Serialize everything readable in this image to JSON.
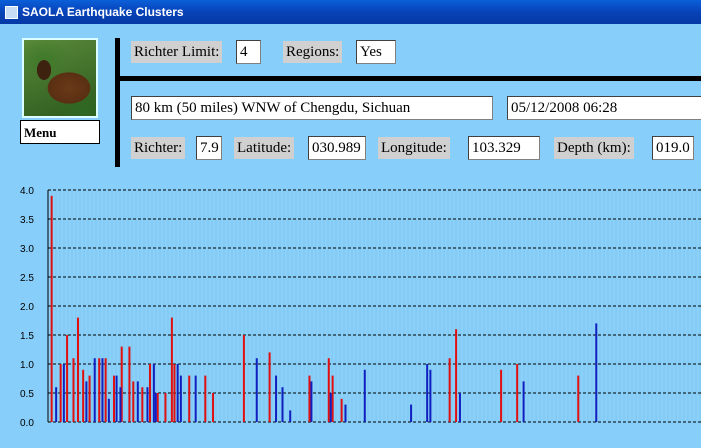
{
  "window": {
    "title": "SAOLA Earthquake Clusters"
  },
  "menu": {
    "label": "Menu"
  },
  "controls": {
    "richter_limit_label": "Richter Limit:",
    "richter_limit_value": "4",
    "regions_label": "Regions:",
    "regions_value": "Yes"
  },
  "event": {
    "location": "80 km (50 miles) WNW of Chengdu, Sichuan",
    "datetime": "05/12/2008 06:28",
    "richter_label": "Richter:",
    "richter_value": "7.9",
    "latitude_label": "Latitude:",
    "latitude_value": "030.989",
    "longitude_label": "Longitude:",
    "longitude_value": "103.329",
    "depth_label": "Depth (km):",
    "depth_value": "019.0"
  },
  "colors": {
    "background": "#87CEFA",
    "red": "#e01010",
    "blue": "#1020c0"
  },
  "chart_data": {
    "type": "bar",
    "yticks": [
      "0.0",
      "0.5",
      "1.0",
      "1.5",
      "2.0",
      "2.5",
      "3.0",
      "3.5",
      "4.0"
    ],
    "ylim": [
      0,
      4.0
    ],
    "grid": true,
    "series": [
      {
        "color": "red",
        "values": [
          [
            0.1,
            3.9
          ],
          [
            1.5,
            1.0
          ],
          [
            2.5,
            1.5
          ],
          [
            3.5,
            1.1
          ],
          [
            4.2,
            1.8
          ],
          [
            5.0,
            0.9
          ],
          [
            6.0,
            0.8
          ],
          [
            7.5,
            1.1
          ],
          [
            8.5,
            1.1
          ],
          [
            9.8,
            0.8
          ],
          [
            11.0,
            1.3
          ],
          [
            12.2,
            1.3
          ],
          [
            12.8,
            0.7
          ],
          [
            14.2,
            0.6
          ],
          [
            15.4,
            1.0
          ],
          [
            16.6,
            0.5
          ],
          [
            17.8,
            0.5
          ],
          [
            18.8,
            1.8
          ],
          [
            19.2,
            1.0
          ],
          [
            21.5,
            0.8
          ],
          [
            24.0,
            0.8
          ],
          [
            25.2,
            0.5
          ],
          [
            30.0,
            1.5
          ],
          [
            34.0,
            1.2
          ],
          [
            40.2,
            0.8
          ],
          [
            43.2,
            1.1
          ],
          [
            43.8,
            0.8
          ],
          [
            45.2,
            0.4
          ],
          [
            62.0,
            1.1
          ],
          [
            63.0,
            1.6
          ],
          [
            70.0,
            0.9
          ],
          [
            72.5,
            1.0
          ],
          [
            82.0,
            0.8
          ]
        ]
      },
      {
        "color": "blue",
        "values": [
          [
            0.8,
            0.6
          ],
          [
            2.0,
            1.0
          ],
          [
            5.5,
            0.7
          ],
          [
            6.8,
            1.1
          ],
          [
            8.0,
            1.1
          ],
          [
            9.0,
            0.4
          ],
          [
            10.2,
            0.8
          ],
          [
            10.8,
            0.6
          ],
          [
            13.5,
            0.7
          ],
          [
            15.0,
            0.6
          ],
          [
            16.0,
            1.0
          ],
          [
            16.3,
            0.5
          ],
          [
            19.7,
            1.0
          ],
          [
            20.2,
            0.8
          ],
          [
            22.5,
            0.8
          ],
          [
            32.0,
            1.1
          ],
          [
            35.0,
            0.8
          ],
          [
            36.0,
            0.6
          ],
          [
            37.2,
            0.2
          ],
          [
            40.5,
            0.7
          ],
          [
            43.5,
            0.5
          ],
          [
            45.8,
            0.3
          ],
          [
            48.8,
            0.9
          ],
          [
            56.0,
            0.3
          ],
          [
            58.5,
            1.0
          ],
          [
            59.0,
            0.9
          ],
          [
            63.6,
            0.5
          ],
          [
            73.5,
            0.7
          ],
          [
            84.8,
            1.7
          ]
        ]
      }
    ]
  }
}
